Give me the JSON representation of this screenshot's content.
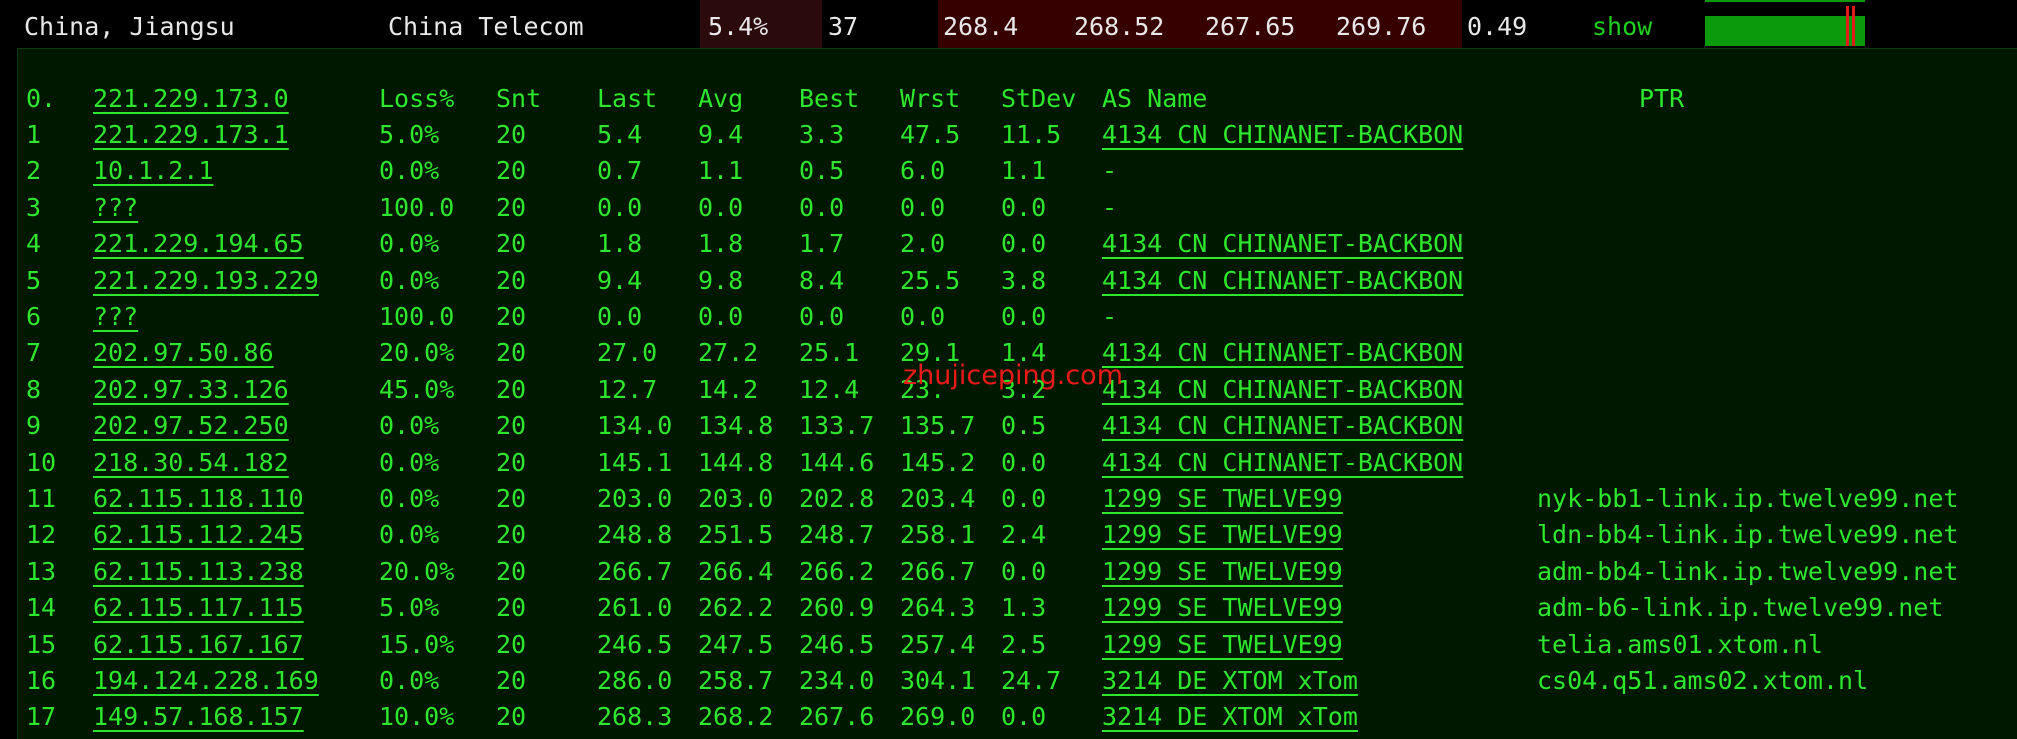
{
  "summary": {
    "location": "China, Jiangsu",
    "isp": "China Telecom",
    "loss": "5.4%",
    "sent": "37",
    "last": "268.4",
    "avg": "268.52",
    "best": "267.65",
    "worst": "269.76",
    "stdev": "0.49",
    "show_label": "show",
    "loss_graph_icon": "latency-graph-bar",
    "colors": {
      "loss_shade": "#2a0a0a",
      "latency_shade": "#360000",
      "graph_green": "#0b9a0b",
      "graph_marker": "#e21a1a",
      "link_green": "#1fd01f"
    }
  },
  "table": {
    "header": {
      "hop": "0.",
      "host": "221.229.173.0",
      "loss": "Loss%",
      "snt": "Snt",
      "last": "Last",
      "avg": "Avg",
      "best": "Best",
      "wrst": "Wrst",
      "stdev": "StDev",
      "as_name": "AS Name",
      "ptr": "PTR"
    },
    "rows": [
      {
        "hop": "1",
        "host": "221.229.173.1",
        "loss": "5.0%",
        "snt": "20",
        "last": "5.4",
        "avg": "9.4",
        "best": "3.3",
        "wrst": "47.5",
        "stdev": "11.5",
        "as": "4134   CN CHINANET-BACKBON",
        "ptr": ""
      },
      {
        "hop": "2",
        "host": "10.1.2.1",
        "loss": "0.0%",
        "snt": "20",
        "last": "0.7",
        "avg": "1.1",
        "best": "0.5",
        "wrst": "6.0",
        "stdev": "1.1",
        "as": "-",
        "ptr": ""
      },
      {
        "hop": "3",
        "host": "???",
        "loss": "100.0",
        "snt": "20",
        "last": "0.0",
        "avg": "0.0",
        "best": "0.0",
        "wrst": "0.0",
        "stdev": "0.0",
        "as": "-",
        "ptr": ""
      },
      {
        "hop": "4",
        "host": "221.229.194.65",
        "loss": "0.0%",
        "snt": "20",
        "last": "1.8",
        "avg": "1.8",
        "best": "1.7",
        "wrst": "2.0",
        "stdev": "0.0",
        "as": "4134   CN CHINANET-BACKBON",
        "ptr": ""
      },
      {
        "hop": "5",
        "host": "221.229.193.229",
        "loss": "0.0%",
        "snt": "20",
        "last": "9.4",
        "avg": "9.8",
        "best": "8.4",
        "wrst": "25.5",
        "stdev": "3.8",
        "as": "4134   CN CHINANET-BACKBON",
        "ptr": ""
      },
      {
        "hop": "6",
        "host": "???",
        "loss": "100.0",
        "snt": "20",
        "last": "0.0",
        "avg": "0.0",
        "best": "0.0",
        "wrst": "0.0",
        "stdev": "0.0",
        "as": "-",
        "ptr": ""
      },
      {
        "hop": "7",
        "host": "202.97.50.86",
        "loss": "20.0%",
        "snt": "20",
        "last": "27.0",
        "avg": "27.2",
        "best": "25.1",
        "wrst": "29.1",
        "stdev": "1.4",
        "as": "4134   CN CHINANET-BACKBON",
        "ptr": ""
      },
      {
        "hop": "8",
        "host": "202.97.33.126",
        "loss": "45.0%",
        "snt": "20",
        "last": "12.7",
        "avg": "14.2",
        "best": "12.4",
        "wrst": "23.",
        "stdev": "3.2",
        "as": "4134   CN CHINANET-BACKBON",
        "ptr": ""
      },
      {
        "hop": "9",
        "host": "202.97.52.250",
        "loss": "0.0%",
        "snt": "20",
        "last": "134.0",
        "avg": "134.8",
        "best": "133.7",
        "wrst": "135.7",
        "stdev": "0.5",
        "as": "4134   CN CHINANET-BACKBON",
        "ptr": ""
      },
      {
        "hop": "10",
        "host": "218.30.54.182",
        "loss": "0.0%",
        "snt": "20",
        "last": "145.1",
        "avg": "144.8",
        "best": "144.6",
        "wrst": "145.2",
        "stdev": "0.0",
        "as": "4134   CN CHINANET-BACKBON",
        "ptr": ""
      },
      {
        "hop": "11",
        "host": "62.115.118.110",
        "loss": "0.0%",
        "snt": "20",
        "last": "203.0",
        "avg": "203.0",
        "best": "202.8",
        "wrst": "203.4",
        "stdev": "0.0",
        "as": "1299   SE TWELVE99",
        "ptr": "nyk-bb1-link.ip.twelve99.net"
      },
      {
        "hop": "12",
        "host": "62.115.112.245",
        "loss": "0.0%",
        "snt": "20",
        "last": "248.8",
        "avg": "251.5",
        "best": "248.7",
        "wrst": "258.1",
        "stdev": "2.4",
        "as": "1299   SE TWELVE99",
        "ptr": "ldn-bb4-link.ip.twelve99.net"
      },
      {
        "hop": "13",
        "host": "62.115.113.238",
        "loss": "20.0%",
        "snt": "20",
        "last": "266.7",
        "avg": "266.4",
        "best": "266.2",
        "wrst": "266.7",
        "stdev": "0.0",
        "as": "1299   SE TWELVE99",
        "ptr": "adm-bb4-link.ip.twelve99.net"
      },
      {
        "hop": "14",
        "host": "62.115.117.115",
        "loss": "5.0%",
        "snt": "20",
        "last": "261.0",
        "avg": "262.2",
        "best": "260.9",
        "wrst": "264.3",
        "stdev": "1.3",
        "as": "1299   SE TWELVE99",
        "ptr": "adm-b6-link.ip.twelve99.net"
      },
      {
        "hop": "15",
        "host": "62.115.167.167",
        "loss": "15.0%",
        "snt": "20",
        "last": "246.5",
        "avg": "247.5",
        "best": "246.5",
        "wrst": "257.4",
        "stdev": "2.5",
        "as": "1299   SE TWELVE99",
        "ptr": "telia.ams01.xtom.nl"
      },
      {
        "hop": "16",
        "host": "194.124.228.169",
        "loss": "0.0%",
        "snt": "20",
        "last": "286.0",
        "avg": "258.7",
        "best": "234.0",
        "wrst": "304.1",
        "stdev": "24.7",
        "as": "3214   DE XTOM xTom",
        "ptr": "cs04.q51.ams02.xtom.nl"
      },
      {
        "hop": "17",
        "host": "149.57.168.157",
        "loss": "10.0%",
        "snt": "20",
        "last": "268.3",
        "avg": "268.2",
        "best": "267.6",
        "wrst": "269.0",
        "stdev": "0.0",
        "as": "3214   DE XTOM xTom",
        "ptr": ""
      }
    ]
  },
  "watermark": "zhujiceping.com",
  "colors": {
    "terminal_bg": "#001800",
    "terminal_text": "#2de62d",
    "watermark": "#ff1a1a"
  }
}
